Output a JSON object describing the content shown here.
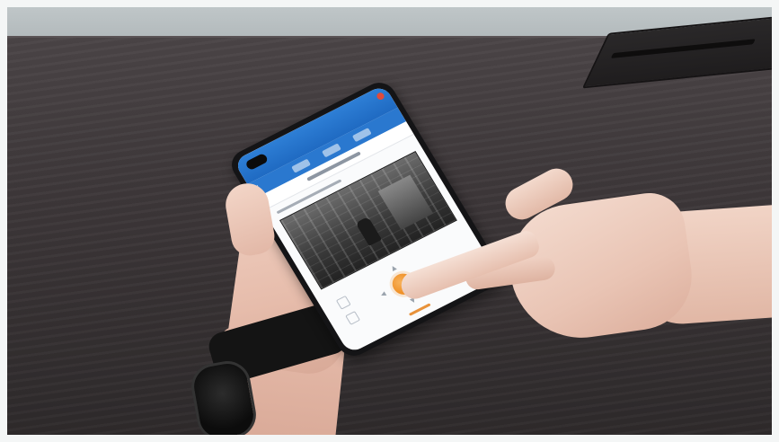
{
  "scene": {
    "description_colors": {
      "table": "#3d3739",
      "wall": "#b4bbbd",
      "phone_header": "#2a78cf",
      "ptz_button": "#ee8a1d",
      "watch": "#141414"
    }
  },
  "phone_screen": {
    "nav_back_icon": "chevron-left-icon",
    "ptz_center_icon": "circle-button",
    "arrow_up": "▲",
    "arrow_down": "▼",
    "arrow_left": "◀",
    "arrow_right": "▶"
  }
}
